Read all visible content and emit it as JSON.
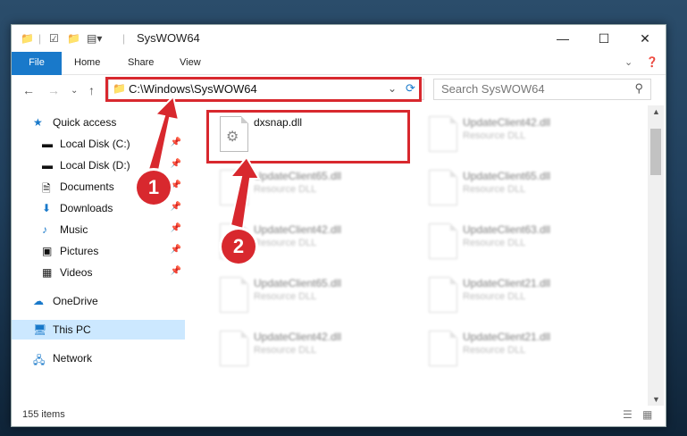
{
  "window": {
    "title": "SysWOW64",
    "controls": {
      "minimize": "—",
      "maximize": "☐",
      "close": "✕"
    }
  },
  "ribbon": {
    "tabs": [
      {
        "label": "File"
      },
      {
        "label": "Home"
      },
      {
        "label": "Share"
      },
      {
        "label": "View"
      }
    ]
  },
  "address": {
    "path": "C:\\Windows\\SysWOW64",
    "search_placeholder": "Search SysWOW64"
  },
  "sidebar": {
    "quick_access": "Quick access",
    "items": [
      {
        "label": "Local Disk (C:)"
      },
      {
        "label": "Local Disk (D:)"
      },
      {
        "label": "Documents"
      },
      {
        "label": "Downloads"
      },
      {
        "label": "Music"
      },
      {
        "label": "Pictures"
      },
      {
        "label": "Videos"
      }
    ],
    "onedrive": "OneDrive",
    "this_pc": "This PC",
    "network": "Network"
  },
  "files": {
    "highlighted": {
      "name": "dxsnap.dll"
    },
    "blurred": [
      {
        "name": "UpdateClient42.dll",
        "type": "Resource DLL"
      },
      {
        "name": "UpdateClient65.dll",
        "type": "Resource DLL"
      },
      {
        "name": "UpdateClient65.dll",
        "type": "Resource DLL"
      },
      {
        "name": "UpdateClient42.dll",
        "type": "Resource DLL"
      },
      {
        "name": "UpdateClient63.dll",
        "type": "Resource DLL"
      },
      {
        "name": "UpdateClient65.dll",
        "type": "Resource DLL"
      },
      {
        "name": "UpdateClient21.dll",
        "type": "Resource DLL"
      },
      {
        "name": "UpdateClient42.dll",
        "type": "Resource DLL"
      },
      {
        "name": "UpdateClient21.dll",
        "type": "Resource DLL"
      }
    ]
  },
  "status": {
    "items": "155 items"
  },
  "annotations": {
    "step1": "1",
    "step2": "2"
  },
  "colors": {
    "accent": "#1979ca",
    "highlight": "#d8282e",
    "selection": "#cce8ff"
  }
}
